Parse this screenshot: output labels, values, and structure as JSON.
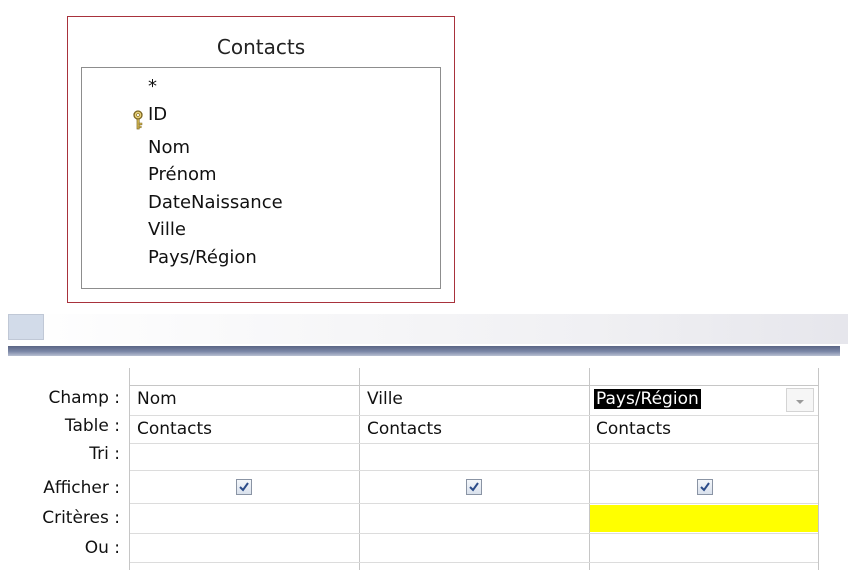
{
  "table": {
    "title": "Contacts",
    "fields": [
      "*",
      "ID",
      "Nom",
      "Prénom",
      "DateNaissance",
      "Ville",
      "Pays/Région"
    ],
    "primary_key_field": "ID",
    "primary_key_icon": "key-icon"
  },
  "grid": {
    "row_labels": {
      "field": "Champ :",
      "table": "Table :",
      "sort": "Tri :",
      "show": "Afficher :",
      "criteria": "Critères :",
      "or": "Ou :"
    },
    "columns": [
      {
        "field": "Nom",
        "table": "Contacts",
        "show": true
      },
      {
        "field": "Ville",
        "table": "Contacts",
        "show": true
      },
      {
        "field": "Pays/Région",
        "table": "Contacts",
        "show": true,
        "selected": true,
        "criteria_highlight_color": "#ffff00"
      }
    ]
  },
  "colors": {
    "table_border": "#a8323c",
    "splitter": "#6a7594",
    "highlight": "#ffff00"
  }
}
